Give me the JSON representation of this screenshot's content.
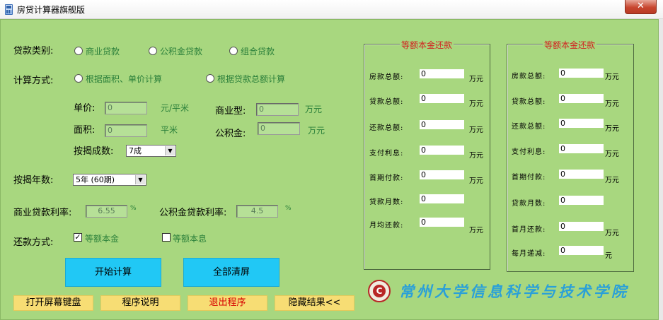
{
  "window": {
    "title": "房贷计算器旗舰版",
    "close_symbol": "✕"
  },
  "loan_type": {
    "label": "贷款类别:",
    "options": [
      "商业贷款",
      "公积金贷款",
      "组合贷款"
    ]
  },
  "calc_method": {
    "label": "计算方式:",
    "options": [
      "根据面积、单价计算",
      "根据贷款总额计算"
    ]
  },
  "fields": {
    "unit_price": {
      "label": "单价:",
      "value": "0",
      "unit": "元/平米"
    },
    "area": {
      "label": "面积:",
      "value": "0",
      "unit": "平米"
    },
    "commercial": {
      "label": "商业型:",
      "value": "0",
      "unit": "万元"
    },
    "fund": {
      "label": "公积金:",
      "value": "0",
      "unit": "万元"
    },
    "mortgage_ratio": {
      "label": "按揭成数:",
      "value": "7成"
    }
  },
  "years": {
    "label": "按揭年数:",
    "value": "5年 (60期)"
  },
  "rates": {
    "commercial": {
      "label": "商业贷款利率:",
      "value": "6.55",
      "unit": "%"
    },
    "fund": {
      "label": "公积金贷款利率:",
      "value": "4.5",
      "unit": "%"
    }
  },
  "repay_method": {
    "label": "还款方式:",
    "options": [
      {
        "label": "等额本金",
        "checked": true,
        "mark": "✓"
      },
      {
        "label": "等额本息",
        "checked": false,
        "mark": ""
      }
    ]
  },
  "buttons": {
    "calculate": "开始计算",
    "clear": "全部清屏",
    "keyboard": "打开屏幕键盘",
    "help": "程序说明",
    "exit": "退出程序",
    "hide": "隐藏结果<<"
  },
  "result_left": {
    "title": "等额本金还款",
    "rows": [
      {
        "label": "房款总额:",
        "value": "0",
        "unit": "万元"
      },
      {
        "label": "贷款总额:",
        "value": "0",
        "unit": "万元"
      },
      {
        "label": "还款总额:",
        "value": "0",
        "unit": "万元"
      },
      {
        "label": "支付利息:",
        "value": "0",
        "unit": "万元"
      },
      {
        "label": "首期付款:",
        "value": "0",
        "unit": "万元"
      },
      {
        "label": "贷款月数:",
        "value": "0",
        "unit": ""
      },
      {
        "label": "月均还款:",
        "value": "0",
        "unit": "万元"
      }
    ]
  },
  "result_right": {
    "title": "等额本金还款",
    "rows": [
      {
        "label": "房款总额:",
        "value": "0",
        "unit": "万元"
      },
      {
        "label": "贷款总额:",
        "value": "0",
        "unit": "万元"
      },
      {
        "label": "还款总额:",
        "value": "0",
        "unit": "万元"
      },
      {
        "label": "支付利息:",
        "value": "0",
        "unit": "万元"
      },
      {
        "label": "首期付款:",
        "value": "0",
        "unit": "万元"
      },
      {
        "label": "贷款月数:",
        "value": "0",
        "unit": ""
      },
      {
        "label": "首月还款:",
        "value": "0",
        "unit": "万元"
      },
      {
        "label": "每月递减:",
        "value": "0",
        "unit": "元"
      }
    ]
  },
  "footer": {
    "logo_letter": "C",
    "college_name": "常州大学信息科学与技术学院"
  },
  "colors": {
    "background": "#a8d77f",
    "primary_button": "#21c8f5",
    "secondary_button": "#f7dd74",
    "group_title": "#d21f1f",
    "college_text": "#2aa0d8"
  }
}
